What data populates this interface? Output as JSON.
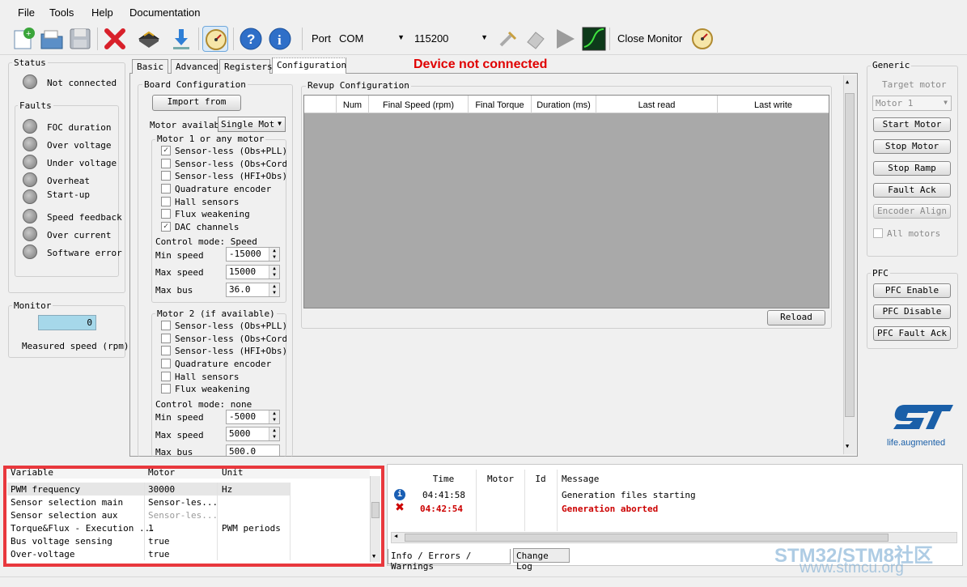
{
  "menu": [
    "File",
    "Tools",
    "Help",
    "Documentation"
  ],
  "toolbar": {
    "port_label": "Port",
    "port_value": "COM",
    "baud_value": "115200",
    "close_monitor": "Close Monitor"
  },
  "banner": "Device not connected",
  "tabs": [
    "Basic",
    "Advanced",
    "Registers",
    "Configuration"
  ],
  "status": {
    "title": "Status",
    "state": "Not connected",
    "faults_title": "Faults",
    "faults": [
      "FOC duration",
      "Over voltage",
      "Under voltage",
      "Overheat",
      "Start-up",
      "Speed feedback",
      "Over current",
      "Software error"
    ]
  },
  "monitor": {
    "title": "Monitor",
    "value": "0",
    "label": "Measured speed (rpm)"
  },
  "board": {
    "title": "Board Configuration",
    "import_btn": "Import from",
    "motor_avail_label": "Motor availabl",
    "motor_avail_value": "Single Mot",
    "motor1": {
      "title": "Motor 1 or any motor",
      "options": [
        {
          "label": "Sensor-less (Obs+PLL)",
          "checked": true
        },
        {
          "label": "Sensor-less (Obs+Cordic",
          "checked": false
        },
        {
          "label": "Sensor-less (HFI+Obs)",
          "checked": false
        },
        {
          "label": "Quadrature encoder",
          "checked": false
        },
        {
          "label": "Hall sensors",
          "checked": false
        },
        {
          "label": "Flux weakening",
          "checked": false
        },
        {
          "label": "DAC channels",
          "checked": true
        }
      ],
      "control_mode": "Control mode: Speed",
      "min_speed_label": "Min speed",
      "min_speed": "-15000",
      "max_speed_label": "Max speed",
      "max_speed": "15000",
      "max_bus_label": "Max bus",
      "max_bus": "36.0"
    },
    "motor2": {
      "title": "Motor 2 (if available)",
      "options": [
        {
          "label": "Sensor-less (Obs+PLL)",
          "checked": false
        },
        {
          "label": "Sensor-less (Obs+Cordic",
          "checked": false
        },
        {
          "label": "Sensor-less (HFI+Obs)",
          "checked": false
        },
        {
          "label": "Quadrature encoder",
          "checked": false
        },
        {
          "label": "Hall sensors",
          "checked": false
        },
        {
          "label": "Flux weakening",
          "checked": false
        }
      ],
      "control_mode": "Control mode: none",
      "min_speed_label": "Min speed",
      "min_speed": "-5000",
      "max_speed_label": "Max speed",
      "max_speed": "5000",
      "max_bus_label": "Max bus",
      "max_bus": "500.0"
    }
  },
  "revup": {
    "title": "Revup Configuration",
    "columns": [
      "Num",
      "Final Speed (rpm)",
      "Final Torque",
      "Duration (ms)",
      "Last read",
      "Last write"
    ],
    "reload_btn": "Reload"
  },
  "generic": {
    "title": "Generic",
    "target_label": "Target motor",
    "target_value": "Motor 1",
    "buttons": [
      "Start Motor",
      "Stop Motor",
      "Stop Ramp",
      "Fault Ack",
      "Encoder Align"
    ],
    "all_motors": "All motors"
  },
  "pfc": {
    "title": "PFC",
    "buttons": [
      "PFC Enable",
      "PFC Disable",
      "PFC Fault Ack"
    ]
  },
  "logo": {
    "text": "life.augmented"
  },
  "vars_table": {
    "columns": [
      "Variable",
      "Motor",
      "Unit"
    ],
    "rows": [
      [
        "PWM frequency",
        "30000",
        "Hz"
      ],
      [
        "Sensor selection main",
        "Sensor-les...",
        ""
      ],
      [
        "Sensor selection aux",
        "Sensor-les...",
        ""
      ],
      [
        "Torque&Flux - Execution ...",
        "1",
        "PWM periods"
      ],
      [
        "Bus voltage sensing",
        "true",
        ""
      ],
      [
        "Over-voltage",
        "true",
        ""
      ]
    ]
  },
  "log": {
    "columns": [
      "Time",
      "Motor",
      "Id",
      "Message"
    ],
    "rows": [
      {
        "type": "info",
        "time": "04:41:58",
        "motor": "",
        "id": "",
        "message": "Generation files starting"
      },
      {
        "type": "error",
        "time": "04:42:54",
        "motor": "",
        "id": "",
        "message": "Generation aborted"
      }
    ],
    "tabs": [
      "Info / Errors / Warnings",
      "Change Log"
    ]
  },
  "watermark": {
    "line1": "STM32/STM8社区",
    "line2": "www.stmcu.org"
  },
  "colors": {
    "banner": "#e00000",
    "error": "#cc0000",
    "highlight": "#e8383d",
    "info": "#1a5fb4"
  }
}
